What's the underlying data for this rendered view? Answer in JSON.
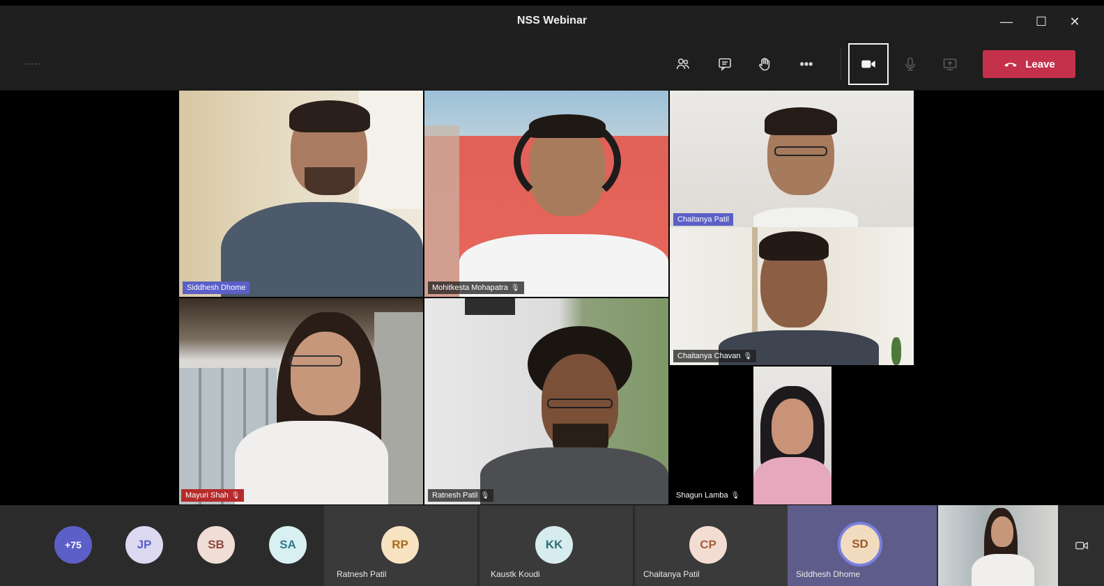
{
  "window": {
    "title": "NSS Webinar",
    "controls": {
      "minimize": "—",
      "maximize": "☐",
      "close": "✕"
    }
  },
  "toolbar": {
    "timer": "·····",
    "buttons": [
      "people-icon",
      "chat-icon",
      "raise-hand-icon",
      "more-icon",
      "camera-icon",
      "mic-icon",
      "share-screen-icon"
    ],
    "more_label": "•••",
    "leave_label": "Leave",
    "leave_color": "#c4314b"
  },
  "videos": [
    {
      "name": "Siddhesh Dhome",
      "highlight": true
    },
    {
      "name": "Mohitkesta Mohapatra",
      "highlight": false,
      "muted": true
    },
    {
      "name": "Chaitanya Patil",
      "highlight": true
    },
    {
      "name": "Chaitanya Chavan",
      "highlight": false,
      "muted": true
    },
    {
      "name": "Mayuri Shah",
      "highlight": false,
      "muted": true
    },
    {
      "name": "Ratnesh Patil",
      "highlight": false,
      "muted": true
    },
    {
      "name": "Shagun Lamba",
      "highlight": false,
      "muted": true
    }
  ],
  "participants": {
    "overflow": {
      "label": "+75",
      "color": "#5b5fc7"
    },
    "avatars": [
      {
        "initials": "JP",
        "name": ""
      },
      {
        "initials": "SB",
        "name": ""
      },
      {
        "initials": "SA",
        "name": ""
      },
      {
        "initials": "RP",
        "name": "Ratnesh Patil"
      },
      {
        "initials": "KK",
        "name": "Kaustk Koudi"
      },
      {
        "initials": "CP",
        "name": "Chaitanya Patil"
      },
      {
        "initials": "SD",
        "name": "Siddhesh Dhome"
      }
    ]
  }
}
